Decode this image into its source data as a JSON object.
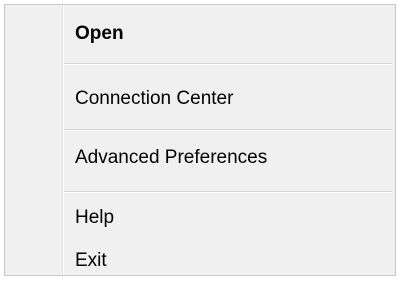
{
  "context_menu": {
    "items": [
      {
        "label": "Open",
        "bold": true
      },
      {
        "label": "Connection Center",
        "bold": false
      },
      {
        "label": "Advanced Preferences",
        "bold": false
      },
      {
        "label": "Help",
        "bold": false
      },
      {
        "label": "Exit",
        "bold": false
      }
    ]
  }
}
